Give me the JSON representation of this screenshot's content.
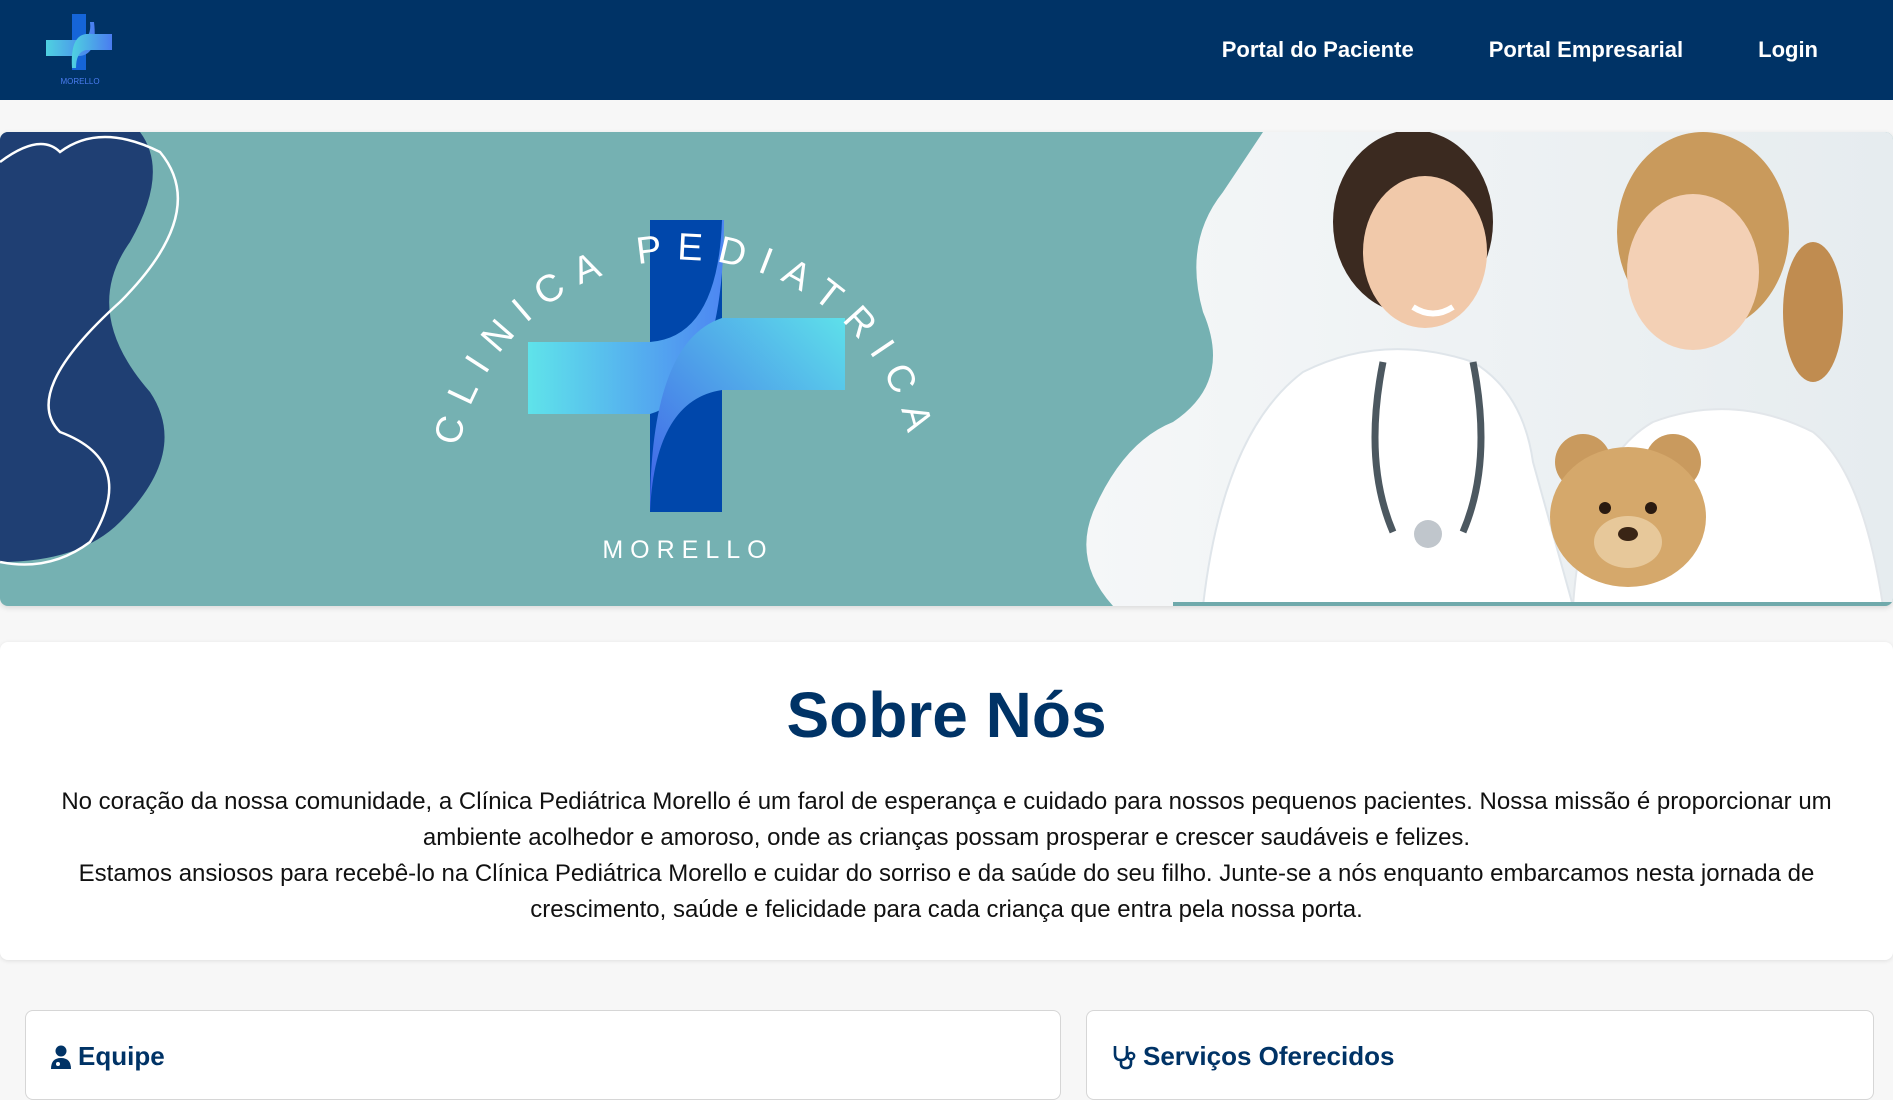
{
  "brand": {
    "logo_text": "MORELLO",
    "colors": {
      "navy": "#003366",
      "teal": "#75b1b2",
      "blue": "#0047ab",
      "cyan": "#4fd1e0"
    }
  },
  "nav": {
    "links": [
      {
        "label": "Portal do Paciente"
      },
      {
        "label": "Portal Empresarial"
      },
      {
        "label": "Login"
      }
    ]
  },
  "hero": {
    "arc_text": "CLINICA PEDIATRICA",
    "name": "MORELLO",
    "photo_icon": "doctor-with-child-photo"
  },
  "about": {
    "title": "Sobre Nós",
    "paragraphs": [
      "No coração da nossa comunidade, a Clínica Pediátrica Morello é um farol de esperança e cuidado para nossos pequenos pacientes. Nossa missão é proporcionar um ambiente acolhedor e amoroso, onde as crianças possam prosperar e crescer saudáveis e felizes.",
      "Estamos ansiosos para recebê-lo na Clínica Pediátrica Morello e cuidar do sorriso e da saúde do seu filho. Junte-se a nós enquanto embarcamos nesta jornada de crescimento, saúde e felicidade para cada criança que entra pela nossa porta."
    ]
  },
  "cards": {
    "team": {
      "title": "Equipe",
      "icon": "user-doctor-icon"
    },
    "services": {
      "title": "Serviços Oferecidos",
      "icon": "stethoscope-icon"
    }
  }
}
